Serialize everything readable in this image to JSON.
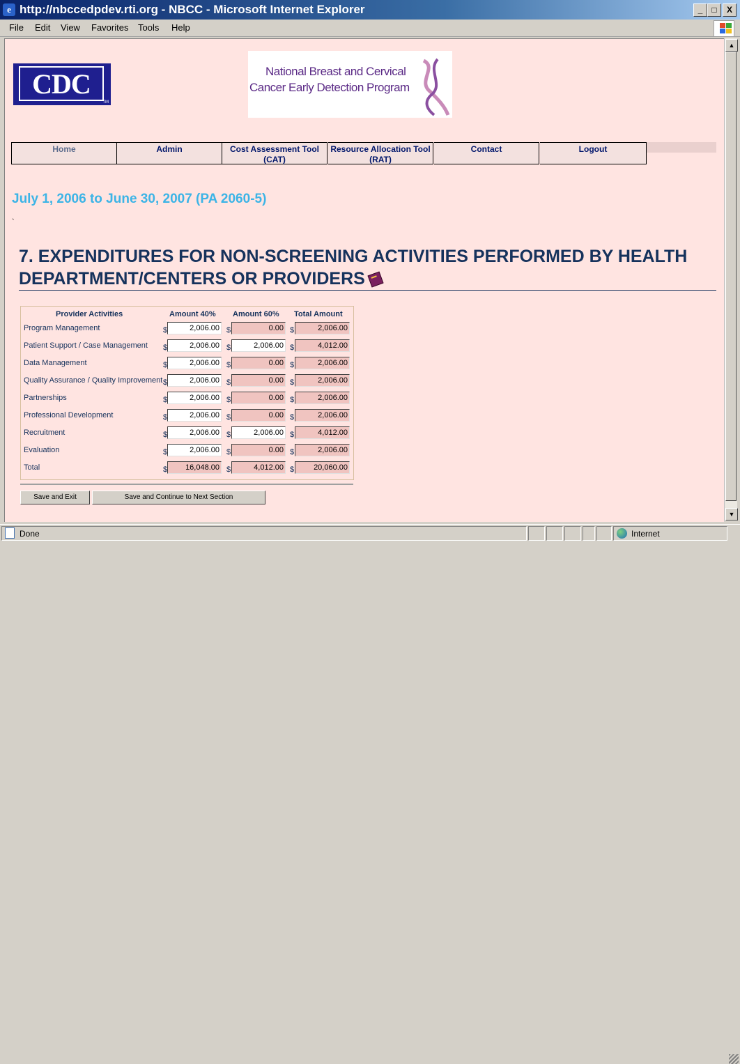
{
  "window": {
    "title": "http://nbccedpdev.rti.org - NBCC - Microsoft Internet Explorer",
    "buttons": {
      "minimize": "_",
      "maximize": "□",
      "close": "X"
    }
  },
  "menu": [
    "File",
    "Edit",
    "View",
    "Favorites",
    "Tools",
    "Help"
  ],
  "logos": {
    "cdc": "CDC",
    "cdc_tm": "TM",
    "program_line1": "National Breast and Cervical",
    "program_line2": "Cancer Early Detection Program"
  },
  "nav": [
    "Home",
    "Admin",
    "Cost Assessment Tool (CAT)",
    "Resource Allocation Tool (RAT)",
    "Contact",
    "Logout"
  ],
  "period": "July 1, 2006 to June 30, 2007 (PA 2060-5)",
  "tick": "`",
  "heading": "7. EXPENDITURES FOR NON-SCREENING ACTIVITIES PERFORMED BY HEALTH DEPARTMENT/CENTERS OR PROVIDERS",
  "table": {
    "headers": [
      "Provider Activities",
      "Amount 40%",
      "Amount 60%",
      "Total Amount"
    ],
    "currency": "$",
    "rows": [
      {
        "label": "Program Management",
        "a40": "2,006.00",
        "a60": "0.00",
        "total": "2,006.00"
      },
      {
        "label": "Patient Support / Case Management",
        "a40": "2,006.00",
        "a60": "2,006.00",
        "total": "4,012.00"
      },
      {
        "label": "Data Management",
        "a40": "2,006.00",
        "a60": "0.00",
        "total": "2,006.00"
      },
      {
        "label": "Quality Assurance / Quality Improvement",
        "a40": "2,006.00",
        "a60": "0.00",
        "total": "2,006.00"
      },
      {
        "label": "Partnerships",
        "a40": "2,006.00",
        "a60": "0.00",
        "total": "2,006.00"
      },
      {
        "label": "Professional Development",
        "a40": "2,006.00",
        "a60": "0.00",
        "total": "2,006.00"
      },
      {
        "label": "Recruitment",
        "a40": "2,006.00",
        "a60": "2,006.00",
        "total": "4,012.00"
      },
      {
        "label": "Evaluation",
        "a40": "2,006.00",
        "a60": "0.00",
        "total": "2,006.00"
      },
      {
        "label": "Total",
        "a40": "16,048.00",
        "a60": "4,012.00",
        "total": "20,060.00"
      }
    ]
  },
  "buttons": {
    "save_exit": "Save and Exit",
    "save_continue": "Save and Continue to Next Section"
  },
  "status": {
    "text": "Done",
    "zone": "Internet"
  },
  "colors": {
    "period": "#3cb4e6",
    "heading": "#16325c",
    "page_bg": "#ffe4e1",
    "readonly_field": "#f0c4c0"
  }
}
